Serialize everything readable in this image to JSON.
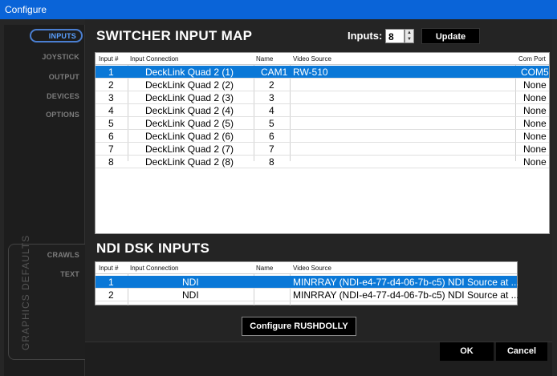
{
  "window": {
    "title": "Configure"
  },
  "sidebar": {
    "items": [
      {
        "label": "INPUTS",
        "active": true
      },
      {
        "label": "JOYSTICK"
      },
      {
        "label": "OUTPUT"
      },
      {
        "label": "DEVICES"
      },
      {
        "label": "OPTIONS"
      }
    ],
    "graphics_label": "GRAPHICS DEFAULTS",
    "graphics_items": [
      {
        "label": "CRAWLS"
      },
      {
        "label": "TEXT"
      }
    ]
  },
  "switcher": {
    "title": "SWITCHER INPUT MAP",
    "inputs_label": "Inputs:",
    "inputs_value": "8",
    "update_label": "Update",
    "columns": [
      "Input #",
      "Input Connection",
      "Name",
      "Video Source",
      "Com Port"
    ],
    "rows": [
      {
        "input": "1",
        "connection": "DeckLink Quad 2 (1)",
        "name": "CAM1",
        "source": "RW-510",
        "com": "COM5",
        "selected": true
      },
      {
        "input": "2",
        "connection": "DeckLink Quad 2 (2)",
        "name": "2",
        "source": "",
        "com": "None"
      },
      {
        "input": "3",
        "connection": "DeckLink Quad 2 (3)",
        "name": "3",
        "source": "",
        "com": "None"
      },
      {
        "input": "4",
        "connection": "DeckLink Quad 2 (4)",
        "name": "4",
        "source": "",
        "com": "None"
      },
      {
        "input": "5",
        "connection": "DeckLink Quad 2 (5)",
        "name": "5",
        "source": "",
        "com": "None"
      },
      {
        "input": "6",
        "connection": "DeckLink Quad 2 (6)",
        "name": "6",
        "source": "",
        "com": "None"
      },
      {
        "input": "7",
        "connection": "DeckLink Quad 2 (7)",
        "name": "7",
        "source": "",
        "com": "None"
      },
      {
        "input": "8",
        "connection": "DeckLink Quad 2 (8)",
        "name": "8",
        "source": "",
        "com": "None"
      }
    ]
  },
  "ndi": {
    "title": "NDI DSK INPUTS",
    "columns": [
      "Input #",
      "Input Connection",
      "Name",
      "Video Source"
    ],
    "rows": [
      {
        "input": "1",
        "connection": "NDI",
        "name": "",
        "source": "MINRRAY (NDI-e4-77-d4-06-7b-c5) NDI Source at ...",
        "selected": true
      },
      {
        "input": "2",
        "connection": "NDI",
        "name": "",
        "source": "MINRRAY (NDI-e4-77-d4-06-7b-c5) NDI Source at ..."
      }
    ]
  },
  "configure_button": "Configure RUSHDOLLY",
  "footer": {
    "ok_label": "OK",
    "cancel_label": "Cancel"
  }
}
